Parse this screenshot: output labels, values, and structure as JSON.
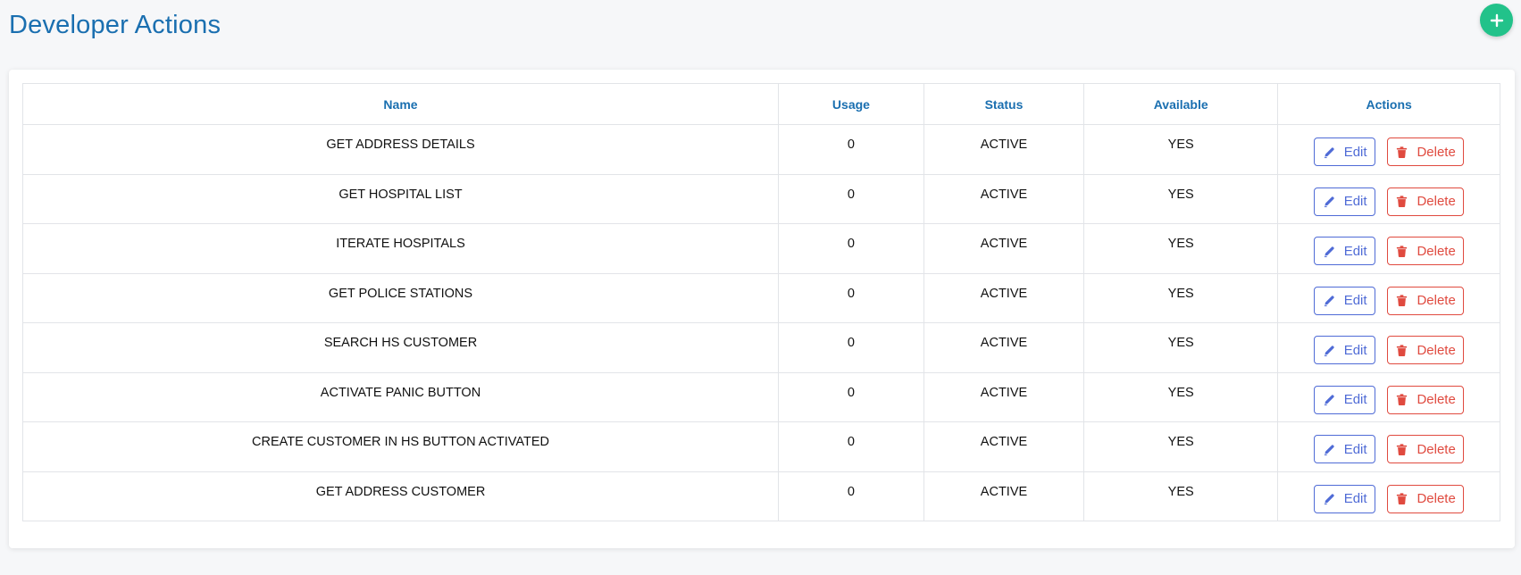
{
  "page": {
    "title": "Developer Actions"
  },
  "header": {
    "add_icon": "plus-icon",
    "add_color": "#22c28a"
  },
  "table": {
    "columns": [
      "Name",
      "Usage",
      "Status",
      "Available",
      "Actions"
    ],
    "rows": [
      {
        "name": "GET ADDRESS DETAILS",
        "usage": "0",
        "status": "ACTIVE",
        "available": "YES"
      },
      {
        "name": "GET HOSPITAL LIST",
        "usage": "0",
        "status": "ACTIVE",
        "available": "YES"
      },
      {
        "name": "ITERATE HOSPITALS",
        "usage": "0",
        "status": "ACTIVE",
        "available": "YES"
      },
      {
        "name": "GET POLICE STATIONS",
        "usage": "0",
        "status": "ACTIVE",
        "available": "YES"
      },
      {
        "name": "SEARCH HS CUSTOMER",
        "usage": "0",
        "status": "ACTIVE",
        "available": "YES"
      },
      {
        "name": "ACTIVATE PANIC BUTTON",
        "usage": "0",
        "status": "ACTIVE",
        "available": "YES"
      },
      {
        "name": "CREATE CUSTOMER IN HS BUTTON ACTIVATED",
        "usage": "0",
        "status": "ACTIVE",
        "available": "YES"
      },
      {
        "name": "GET ADDRESS CUSTOMER",
        "usage": "0",
        "status": "ACTIVE",
        "available": "YES"
      }
    ],
    "edit_label": "Edit",
    "delete_label": "Delete",
    "edit_icon": "pencil-icon",
    "delete_icon": "trash-icon",
    "edit_color": "#4f6bd6",
    "delete_color": "#e04a3f",
    "header_color": "#1a6fb0"
  }
}
